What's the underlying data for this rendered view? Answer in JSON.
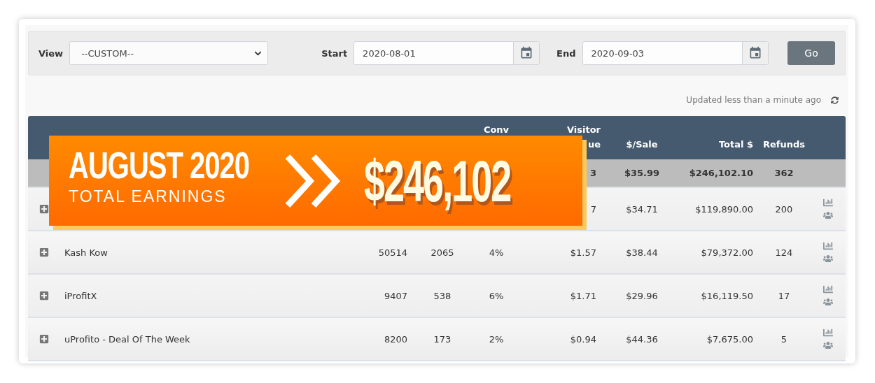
{
  "filters": {
    "view_label": "View",
    "view_value": "--CUSTOM--",
    "start_label": "Start",
    "start_value": "2020-08-01",
    "end_label": "End",
    "end_value": "2020-09-03",
    "go": "Go"
  },
  "updated": "Updated less than a minute ago",
  "table": {
    "header": {
      "column_5": [
        "Conv"
      ],
      "column_6": [
        "Visitor",
        "ue"
      ],
      "column_7": [
        "$/Sale"
      ],
      "column_8": [
        "Total $"
      ],
      "column_9": [
        "Refunds"
      ]
    },
    "rows": [
      {
        "kind": "total",
        "cells": {
          "column_6": "3",
          "column_7": "$35.99",
          "column_8": "$246,102.10",
          "column_9": "362"
        }
      },
      {
        "kind": "item",
        "cells": {
          "column_6": "7",
          "column_7": "$34.71",
          "column_8": "$119,890.00",
          "column_9": "200"
        }
      },
      {
        "kind": "item",
        "cells": {
          "column_2": "Kash Kow",
          "column_3": "50514",
          "column_4": "2065",
          "column_5": "4%",
          "column_6": "$1.57",
          "column_7": "$38.44",
          "column_8": "$79,372.00",
          "column_9": "124"
        }
      },
      {
        "kind": "item",
        "cells": {
          "column_2": "iProfitX",
          "column_3": "9407",
          "column_4": "538",
          "column_5": "6%",
          "column_6": "$1.71",
          "column_7": "$29.96",
          "column_8": "$16,119.50",
          "column_9": "17"
        }
      },
      {
        "kind": "item",
        "cells": {
          "column_2": "uProfito - Deal Of The Week",
          "column_3": "8200",
          "column_4": "173",
          "column_5": "2%",
          "column_6": "$0.94",
          "column_7": "$44.36",
          "column_8": "$7,675.00",
          "column_9": "5"
        }
      }
    ]
  },
  "banner": {
    "title": "AUGUST 2020",
    "subtitle": "TOTAL EARNINGS",
    "amount": "$246,102"
  }
}
